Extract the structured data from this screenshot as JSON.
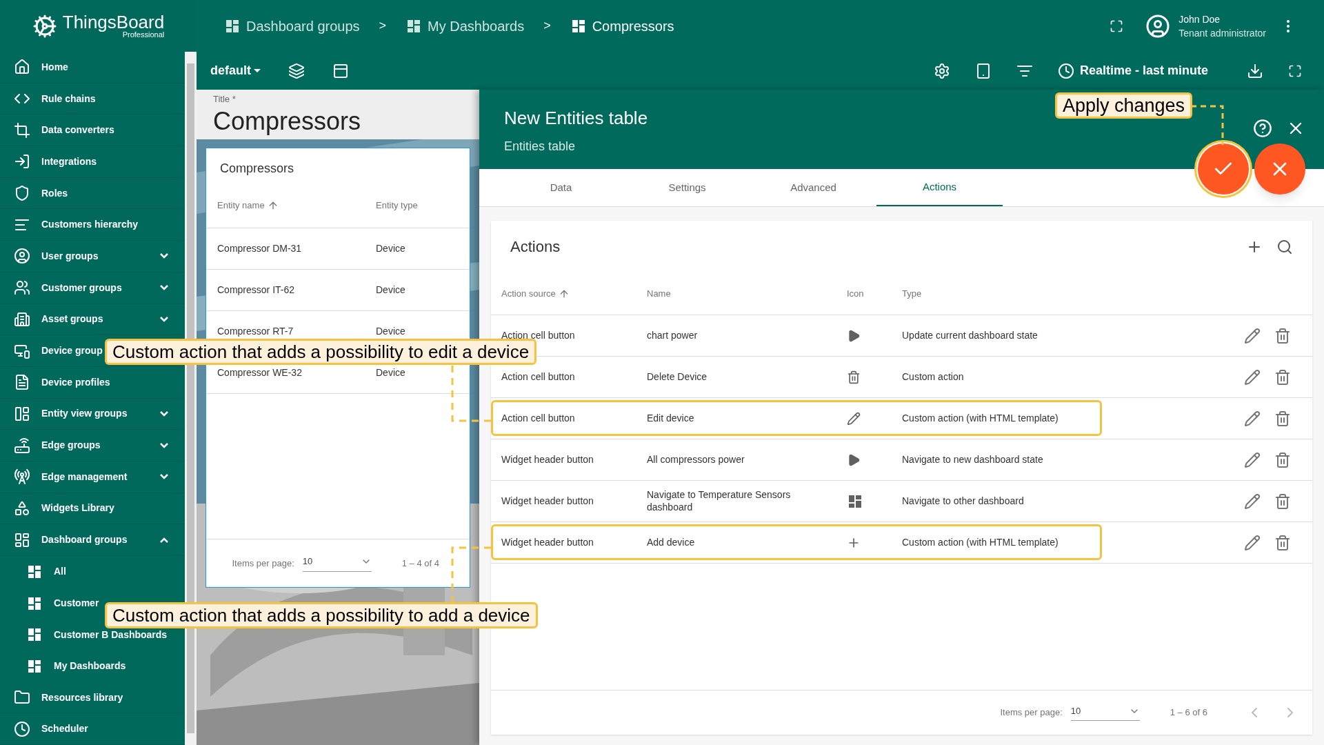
{
  "logo": {
    "name": "ThingsBoard",
    "edition": "Professional"
  },
  "sidebar": {
    "items": [
      {
        "label": "Home"
      },
      {
        "label": "Rule chains"
      },
      {
        "label": "Data converters"
      },
      {
        "label": "Integrations"
      },
      {
        "label": "Roles"
      },
      {
        "label": "Customers hierarchy"
      },
      {
        "label": "User groups",
        "expanded": false
      },
      {
        "label": "Customer groups",
        "expanded": false
      },
      {
        "label": "Asset groups",
        "expanded": false
      },
      {
        "label": "Device group"
      },
      {
        "label": "Device profiles"
      },
      {
        "label": "Entity view groups",
        "expanded": false
      },
      {
        "label": "Edge groups",
        "expanded": false
      },
      {
        "label": "Edge management",
        "expanded": false
      },
      {
        "label": "Widgets Library"
      },
      {
        "label": "Dashboard groups",
        "expanded": true,
        "children": [
          {
            "label": "All"
          },
          {
            "label": "Customer"
          },
          {
            "label": "Customer B Dashboards"
          },
          {
            "label": "My Dashboards"
          }
        ]
      },
      {
        "label": "Resources library"
      },
      {
        "label": "Scheduler"
      }
    ]
  },
  "breadcrumbs": [
    "Dashboard groups",
    "My Dashboards",
    "Compressors"
  ],
  "breadcrumb_separator": ">",
  "user": {
    "name": "John Doe",
    "role": "Tenant administrator"
  },
  "toolbar": {
    "state": "default",
    "timewindow": "Realtime - last minute"
  },
  "dashboard": {
    "title_label": "Title *",
    "title": "Compressors",
    "widget": {
      "title": "Compressors",
      "columns": [
        "Entity name",
        "Entity type"
      ],
      "rows": [
        [
          "Compressor DM-31",
          "Device"
        ],
        [
          "Compressor IT-62",
          "Device"
        ],
        [
          "Compressor RT-7",
          "Device"
        ],
        [
          "Compressor WE-32",
          "Device"
        ]
      ],
      "items_per_page_label": "Items per page:",
      "items_per_page": "10",
      "range": "1 – 4 of 4"
    }
  },
  "panel": {
    "title": "New Entities table",
    "subtitle": "Entities table",
    "tabs": [
      {
        "label": "Data",
        "selected": false
      },
      {
        "label": "Settings",
        "selected": false
      },
      {
        "label": "Advanced",
        "selected": false
      },
      {
        "label": "Actions",
        "selected": true
      }
    ],
    "actions": {
      "title": "Actions",
      "columns": [
        "Action source",
        "Name",
        "Icon",
        "Type"
      ],
      "rows": [
        {
          "source": "Action cell button",
          "name": "chart power",
          "type": "Update current dashboard state",
          "highlighted": false
        },
        {
          "source": "Action cell button",
          "name": "Delete Device",
          "type": "Custom action",
          "highlighted": false
        },
        {
          "source": "Action cell button",
          "name": "Edit device",
          "type": "Custom action (with HTML template)",
          "highlighted": true
        },
        {
          "source": "Widget header button",
          "name": "All compressors power",
          "type": "Navigate to new dashboard state",
          "highlighted": false
        },
        {
          "source": "Widget header button",
          "name": "Navigate to Temperature Sensors dashboard",
          "type": "Navigate to other dashboard",
          "highlighted": false
        },
        {
          "source": "Widget header button",
          "name": "Add device",
          "type": "Custom action (with HTML template)",
          "highlighted": true
        }
      ],
      "items_per_page_label": "Items per page:",
      "items_per_page": "10",
      "range": "1 – 6 of 6"
    }
  },
  "annotations": [
    "Apply changes",
    "Custom action that adds a possibility to edit a device",
    "Custom action that adds a possibility to add a device"
  ]
}
